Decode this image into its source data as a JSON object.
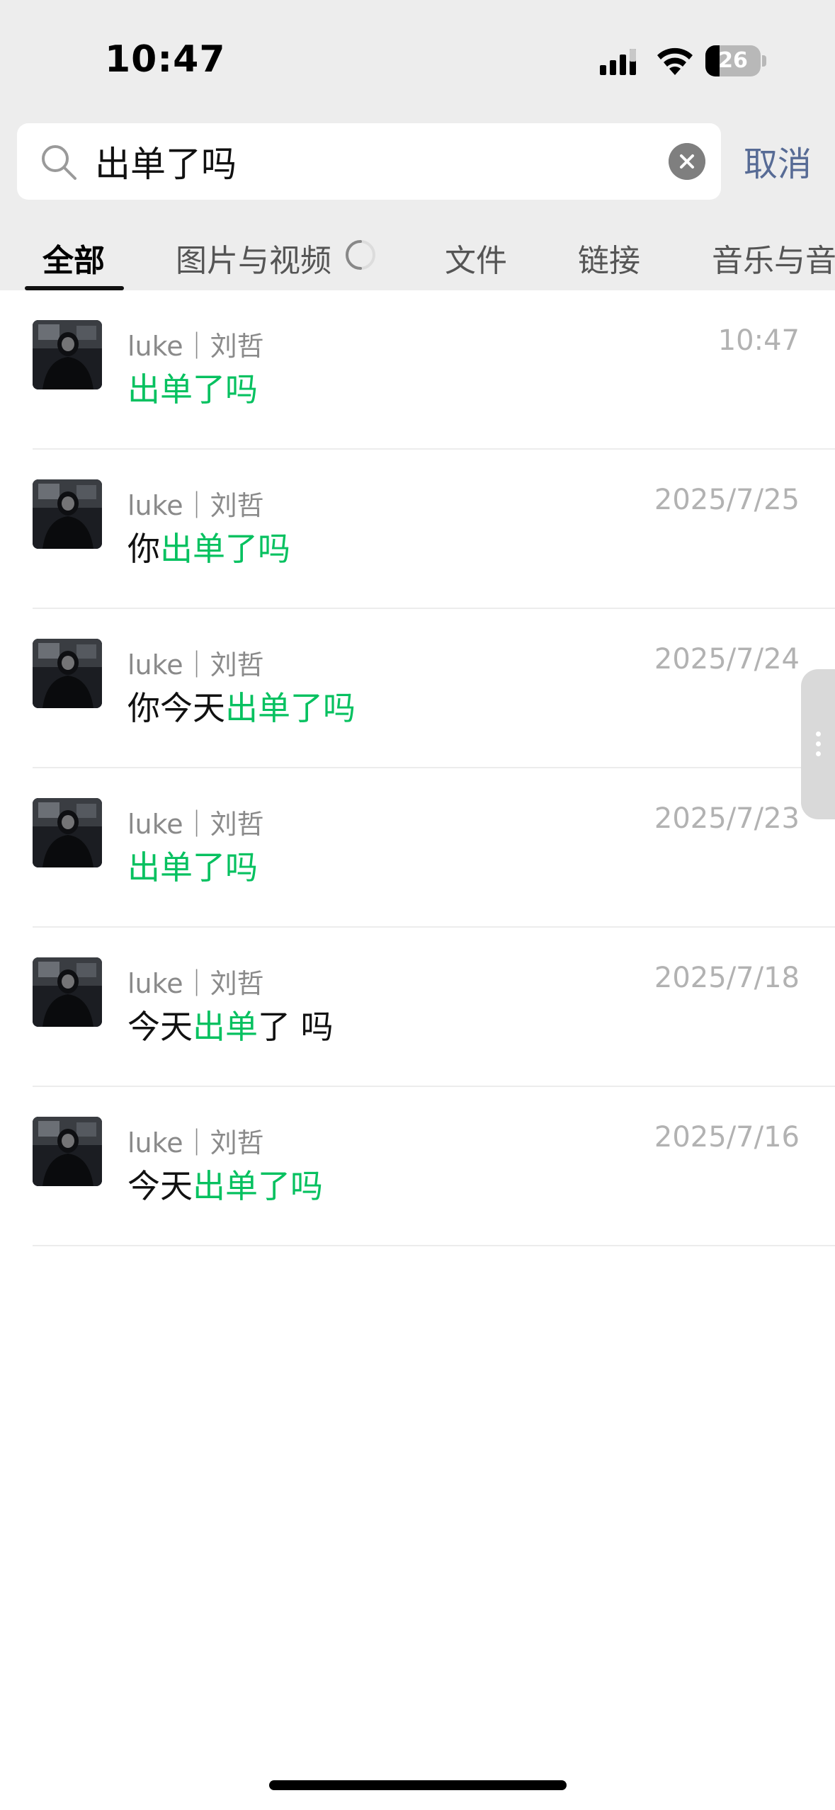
{
  "status_bar": {
    "time": "10:47",
    "battery_level": "26",
    "battery_fraction": 0.26
  },
  "search": {
    "query": "出单了吗",
    "cancel_label": "取消"
  },
  "tabs": [
    {
      "label": "全部",
      "active": true
    },
    {
      "label": "图片与视频",
      "active": false,
      "loading": true
    },
    {
      "label": "文件",
      "active": false
    },
    {
      "label": "链接",
      "active": false
    },
    {
      "label": "音乐与音",
      "active": false
    }
  ],
  "results": [
    {
      "sender": "luke｜刘哲",
      "date": "10:47",
      "segments": [
        {
          "text": "出单了吗",
          "highlight": true
        }
      ]
    },
    {
      "sender": "luke｜刘哲",
      "date": "2025/7/25",
      "segments": [
        {
          "text": "你",
          "highlight": false
        },
        {
          "text": "出单了吗",
          "highlight": true
        }
      ]
    },
    {
      "sender": "luke｜刘哲",
      "date": "2025/7/24",
      "segments": [
        {
          "text": "你今天",
          "highlight": false
        },
        {
          "text": "出单了吗",
          "highlight": true
        }
      ]
    },
    {
      "sender": "luke｜刘哲",
      "date": "2025/7/23",
      "segments": [
        {
          "text": "出单了吗",
          "highlight": true
        }
      ]
    },
    {
      "sender": "luke｜刘哲",
      "date": "2025/7/18",
      "segments": [
        {
          "text": "今天",
          "highlight": false
        },
        {
          "text": "出单",
          "highlight": true
        },
        {
          "text": "了 吗",
          "highlight": false
        }
      ]
    },
    {
      "sender": "luke｜刘哲",
      "date": "2025/7/16",
      "segments": [
        {
          "text": "今天",
          "highlight": false
        },
        {
          "text": "出单了吗",
          "highlight": true
        }
      ]
    }
  ],
  "colors": {
    "highlight": "#07c160",
    "link": "#576b95",
    "header_bg": "#ededed"
  }
}
